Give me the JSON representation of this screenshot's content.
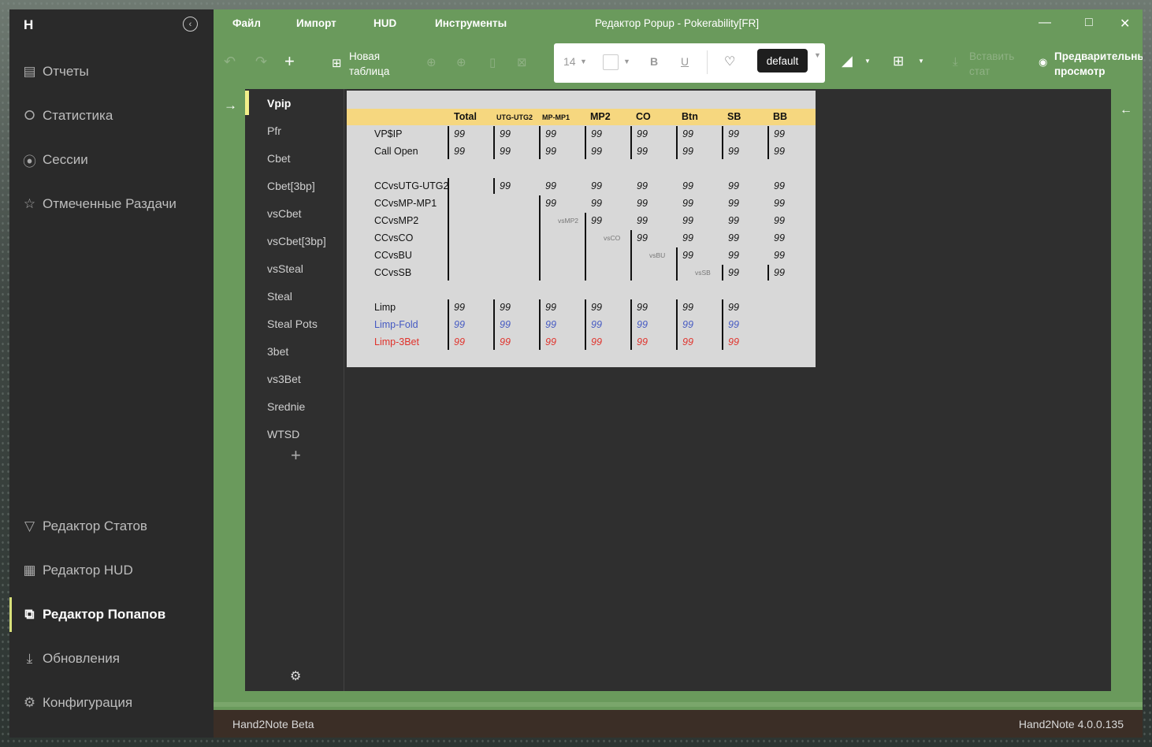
{
  "app": {
    "logo": "H",
    "collapse_icon": "collapse-left-icon"
  },
  "sidebar": {
    "top": [
      {
        "label": "Отчеты",
        "icon": "report-icon"
      },
      {
        "label": "Статистика",
        "icon": "stats-icon"
      },
      {
        "label": "Сессии",
        "icon": "sessions-icon"
      },
      {
        "label": "Отмеченные Раздачи",
        "icon": "star-icon"
      }
    ],
    "bottom": [
      {
        "label": "Редактор Статов",
        "icon": "filter-icon"
      },
      {
        "label": "Редактор HUD",
        "icon": "hud-icon"
      },
      {
        "label": "Редактор Попапов",
        "icon": "popup-icon",
        "active": true
      },
      {
        "label": "Обновления",
        "icon": "download-icon"
      },
      {
        "label": "Конфигурация",
        "icon": "gear-icon"
      }
    ]
  },
  "menu": {
    "items": [
      "Файл",
      "Импорт",
      "HUD",
      "Инструменты"
    ],
    "title": "Редактор Popup - Pokerability[FR]"
  },
  "toolbar": {
    "new_table_l1": "Новая",
    "new_table_l2": "таблица",
    "font_size": "14",
    "bold": "B",
    "underline": "U",
    "style": "default",
    "insert_l1": "Вставить",
    "insert_l2": "стат",
    "preview_l1": "Предварительный",
    "preview_l2": "просмотр"
  },
  "tabs": [
    "Vpip",
    "Pfr",
    "Cbet",
    "Cbet[3bp]",
    "vsCbet",
    "vsCbet[3bp]",
    "vsSteal",
    "Steal",
    "Steal Pots",
    "3bet",
    "vs3Bet",
    "Srednie",
    "WTSD"
  ],
  "table": {
    "headers": [
      "Total",
      "UTG-UTG2",
      "MP-MP1",
      "MP2",
      "CO",
      "Btn",
      "SB",
      "BB"
    ],
    "value": "99",
    "rows": [
      {
        "label": "VP$IP",
        "color": "#111111"
      },
      {
        "label": "Call Open",
        "color": "#111111"
      },
      {
        "label": "CCvsUTG-UTG2",
        "color": "#111111"
      },
      {
        "label": "CCvsMP-MP1",
        "color": "#111111"
      },
      {
        "label": "CCvsMP2",
        "color": "#111111"
      },
      {
        "label": "CCvsCO",
        "color": "#111111"
      },
      {
        "label": "CCvsBU",
        "color": "#111111"
      },
      {
        "label": "CCvsSB",
        "color": "#111111"
      },
      {
        "label": "Limp",
        "color": "#111111"
      },
      {
        "label": "Limp-Fold",
        "color": "#4459c2"
      },
      {
        "label": "Limp-3Bet",
        "color": "#e0322b"
      }
    ],
    "vs_labels": [
      "vsMP2",
      "vsCO",
      "vsBU",
      "vsSB"
    ]
  },
  "status": {
    "left": "Hand2Note Beta",
    "right": "Hand2Note 4.0.0.135"
  }
}
